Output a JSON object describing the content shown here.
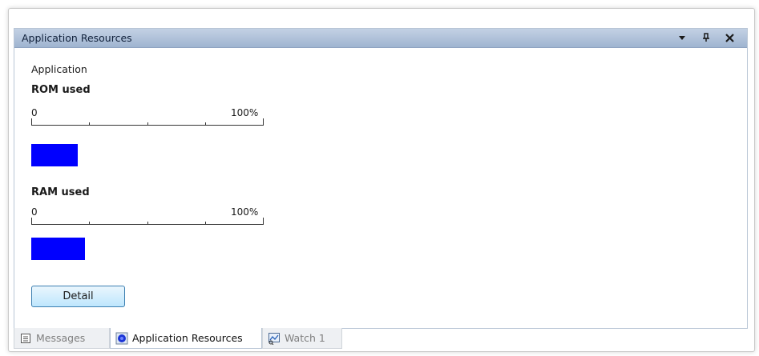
{
  "panel": {
    "title": "Application Resources",
    "controls": {
      "dropdown_icon": "chevron-down-icon",
      "pin_icon": "pin-icon",
      "close_icon": "close-icon"
    }
  },
  "content": {
    "group_label": "Application",
    "rom": {
      "title": "ROM used",
      "scale_min": "0",
      "scale_max": "100%",
      "used_fraction": 0.2
    },
    "ram": {
      "title": "RAM used",
      "scale_min": "0",
      "scale_max": "100%",
      "used_fraction": 0.23
    },
    "detail_button": "Detail"
  },
  "tabs": [
    {
      "label": "Messages",
      "icon": "messages-icon",
      "active": false
    },
    {
      "label": "Application Resources",
      "icon": "chip-icon",
      "active": true
    },
    {
      "label": "Watch 1",
      "icon": "watch-icon",
      "active": false
    }
  ],
  "colors": {
    "usage_bar": "#0000ff",
    "title_bar": "#b2c4dc"
  }
}
